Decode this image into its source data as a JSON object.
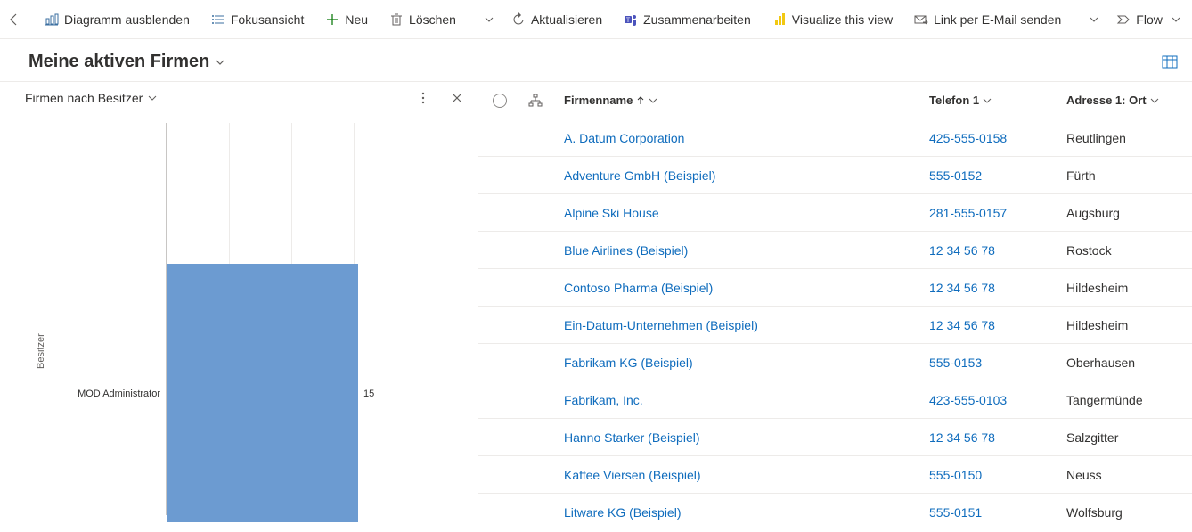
{
  "toolbar": {
    "hide_diagram": "Diagramm ausblenden",
    "focus_view": "Fokusansicht",
    "new": "Neu",
    "delete": "Löschen",
    "refresh": "Aktualisieren",
    "collaborate": "Zusammenarbeiten",
    "visualize": "Visualize this view",
    "email_link": "Link per E-Mail senden",
    "flow": "Flow"
  },
  "view": {
    "title": "Meine aktiven Firmen"
  },
  "chart": {
    "title": "Firmen nach Besitzer",
    "ylabel": "Besitzer",
    "category_label": "MOD Administrator",
    "value_label": "15"
  },
  "grid": {
    "headers": {
      "name": "Firmenname",
      "phone": "Telefon 1",
      "city": "Adresse 1: Ort"
    },
    "rows": [
      {
        "name": "A. Datum Corporation",
        "phone": "425-555-0158",
        "city": "Reutlingen"
      },
      {
        "name": "Adventure GmbH (Beispiel)",
        "phone": "555-0152",
        "city": "Fürth"
      },
      {
        "name": "Alpine Ski House",
        "phone": "281-555-0157",
        "city": "Augsburg"
      },
      {
        "name": "Blue Airlines (Beispiel)",
        "phone": "12 34 56 78",
        "city": "Rostock"
      },
      {
        "name": "Contoso Pharma (Beispiel)",
        "phone": "12 34 56 78",
        "city": "Hildesheim"
      },
      {
        "name": "Ein-Datum-Unternehmen (Beispiel)",
        "phone": "12 34 56 78",
        "city": "Hildesheim"
      },
      {
        "name": "Fabrikam KG (Beispiel)",
        "phone": "555-0153",
        "city": "Oberhausen"
      },
      {
        "name": "Fabrikam, Inc.",
        "phone": "423-555-0103",
        "city": "Tangermünde"
      },
      {
        "name": "Hanno Starker (Beispiel)",
        "phone": "12 34 56 78",
        "city": "Salzgitter"
      },
      {
        "name": "Kaffee Viersen (Beispiel)",
        "phone": "555-0150",
        "city": "Neuss"
      },
      {
        "name": "Litware KG (Beispiel)",
        "phone": "555-0151",
        "city": "Wolfsburg"
      }
    ]
  },
  "chart_data": {
    "type": "bar",
    "orientation": "horizontal",
    "categories": [
      "MOD Administrator"
    ],
    "values": [
      15
    ],
    "title": "Firmen nach Besitzer",
    "xlabel": "",
    "ylabel": "Besitzer",
    "xlim": [
      0,
      18
    ]
  }
}
